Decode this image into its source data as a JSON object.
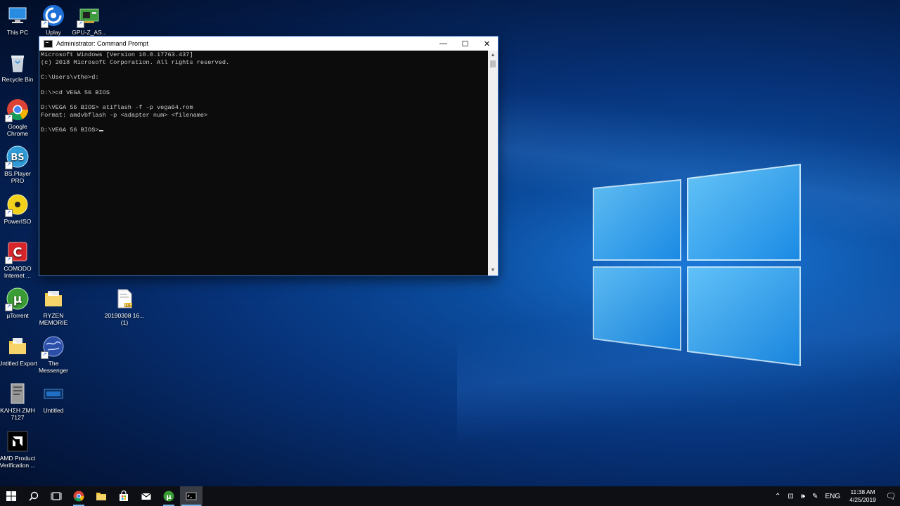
{
  "desktop": {
    "icons": [
      {
        "label": "This PC"
      },
      {
        "label": "Uplay"
      },
      {
        "label": "GPU-Z_AS..."
      },
      {
        "label": "Recycle Bin"
      },
      {
        "label": "Google Chrome"
      },
      {
        "label": "BS.Player PRO"
      },
      {
        "label": "PowerISO"
      },
      {
        "label": "COMODO Internet ..."
      },
      {
        "label": "µTorrent"
      },
      {
        "label": "RYZEN MEMORIE"
      },
      {
        "label": "20190308 16... (1)"
      },
      {
        "label": "Untitled Export"
      },
      {
        "label": "The Messenger"
      },
      {
        "label": "ΚΛΗΣΗ ΖΜΗ 7127"
      },
      {
        "label": "Untitled"
      },
      {
        "label": "AMD Product Verification ..."
      }
    ]
  },
  "cmd": {
    "title": "Administrator: Command Prompt",
    "lines": [
      "Microsoft Windows [Version 10.0.17763.437]",
      "(c) 2018 Microsoft Corporation. All rights reserved.",
      "",
      "C:\\Users\\vtho>d:",
      "",
      "D:\\>cd VEGA 56 BIOS",
      "",
      "D:\\VEGA 56 BIOS> atiflash -f -p vega64.rom",
      "Format: amdvbflash -p <adapter num> <filename>",
      "",
      "D:\\VEGA 56 BIOS>"
    ],
    "minimize": "—",
    "maximize": "☐",
    "close": "✕"
  },
  "taskbar": {
    "tray": {
      "language": "ENG",
      "time": "11:38 AM",
      "date": "4/25/2019"
    }
  },
  "colors": {
    "accent": "#76b9ed",
    "console_bg": "#0c0c0c",
    "console_fg": "#cccccc"
  }
}
